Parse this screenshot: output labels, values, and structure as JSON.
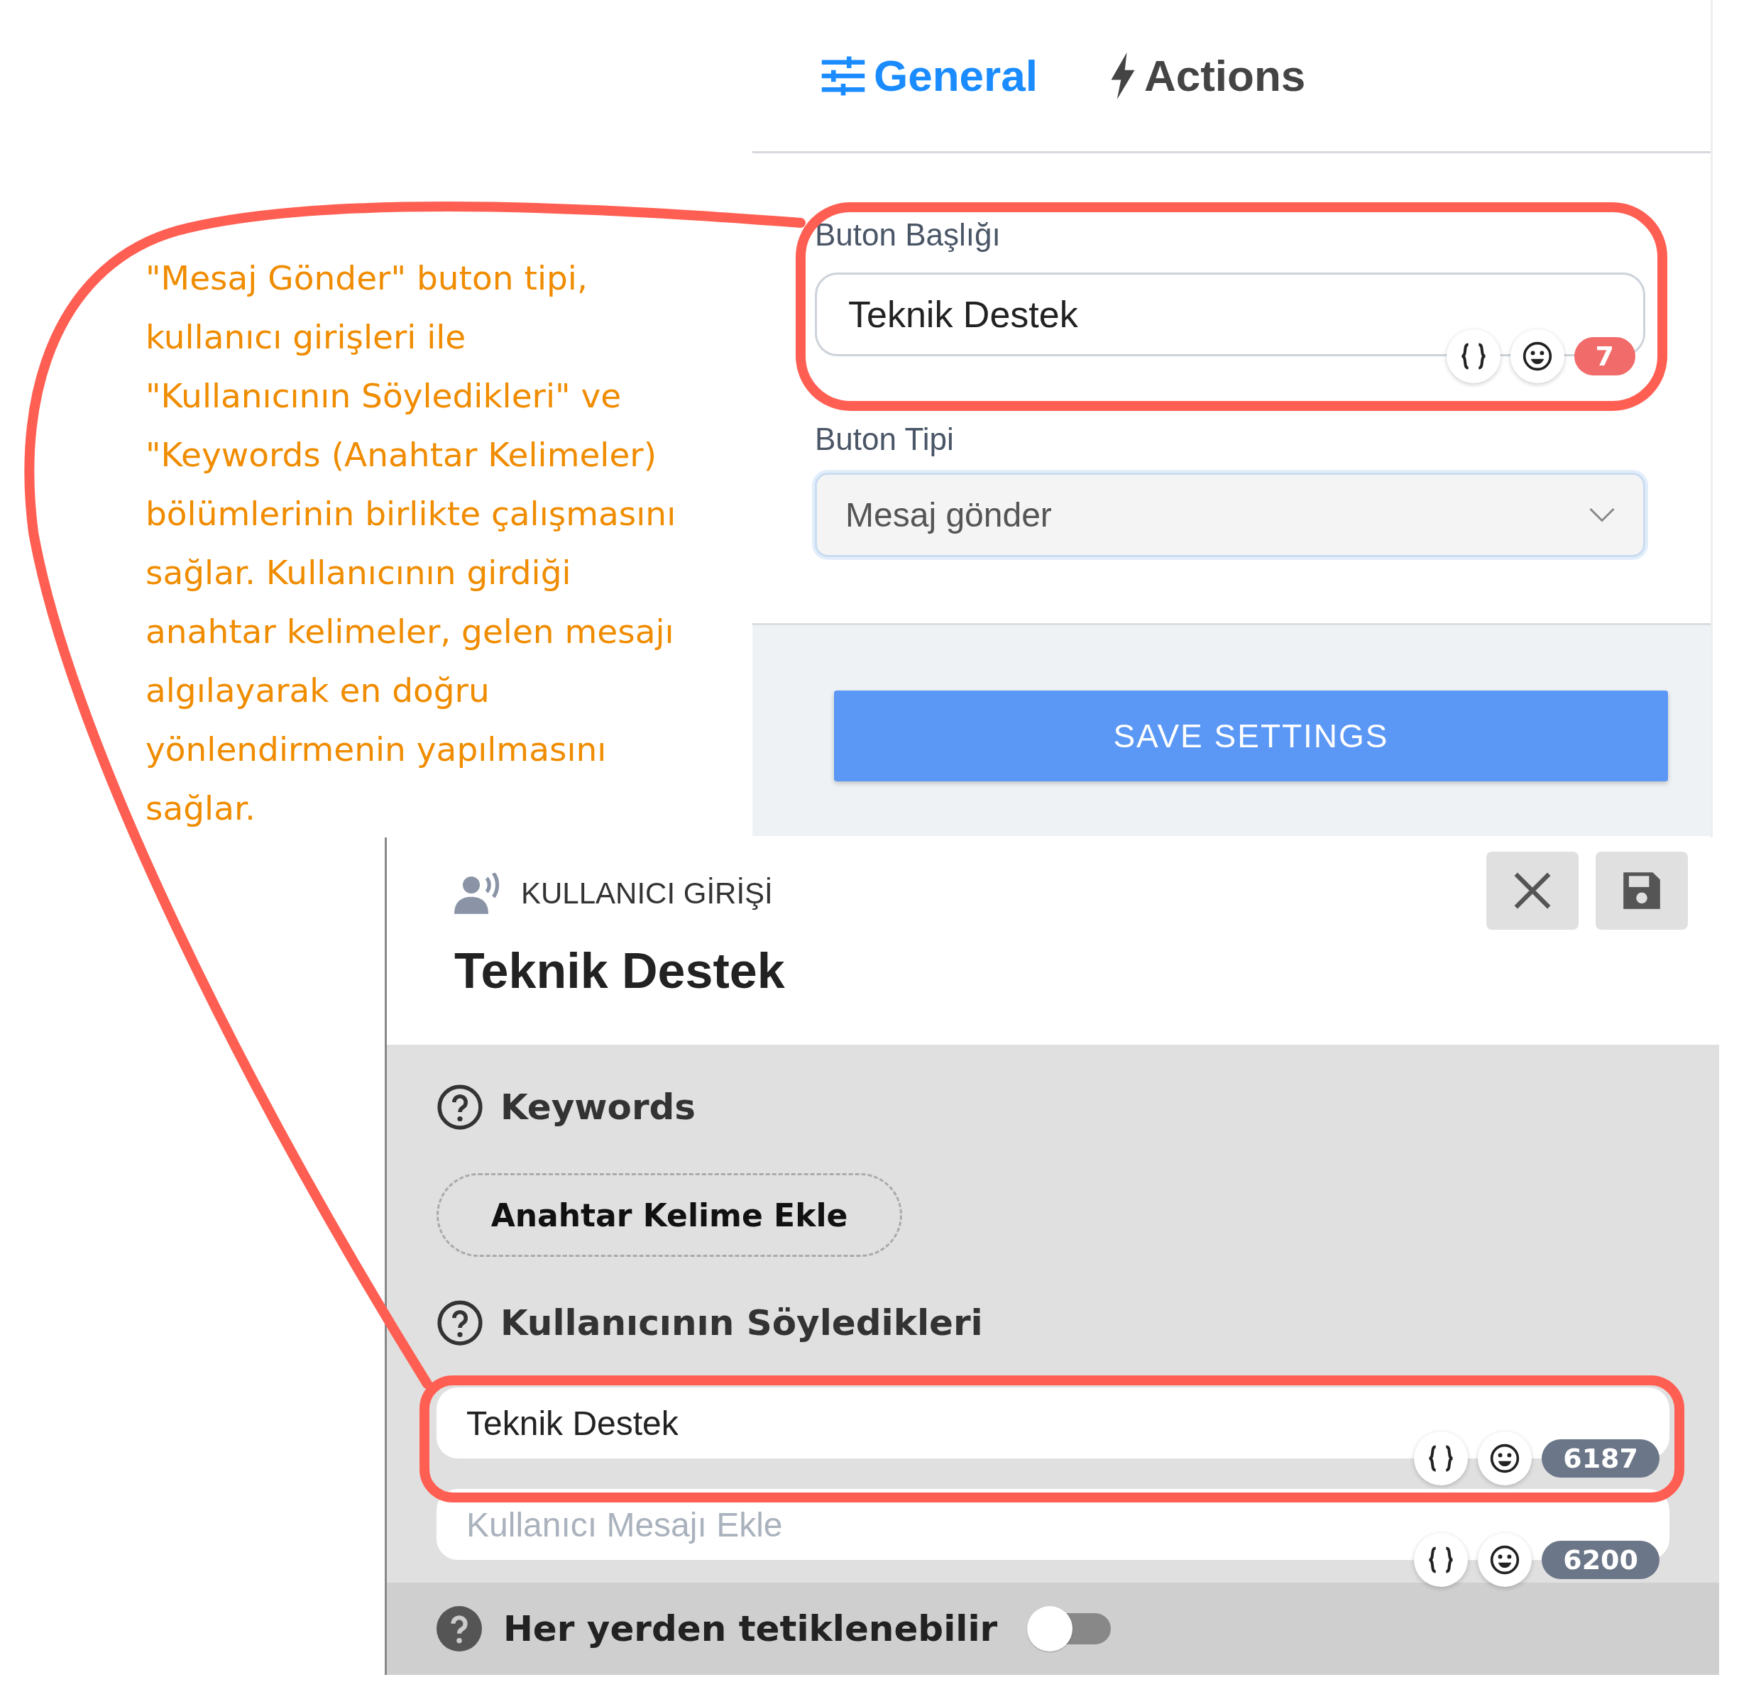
{
  "tabs": [
    {
      "label": "General",
      "selected": true
    },
    {
      "label": "Actions",
      "selected": false
    }
  ],
  "button_settings": {
    "title_field": {
      "label": "Buton Başlığı",
      "value": "Teknik Destek",
      "count": "7"
    },
    "type_field": {
      "label": "Buton Tipi",
      "value": "Mesaj gönder"
    },
    "save_button": "SAVE SETTINGS"
  },
  "user_input_panel": {
    "kind_label": "KULLANICI GİRİŞİ",
    "title": "Teknik Destek",
    "keywords": {
      "heading": "Keywords",
      "add_button": "Anahtar Kelime Ekle"
    },
    "utterances": {
      "heading": "Kullanıcının Söyledikleri",
      "items": [
        {
          "value": "Teknik Destek",
          "count": "6187"
        },
        {
          "placeholder": "Kullanıcı Mesajı Ekle",
          "count": "6200"
        }
      ]
    },
    "trigger_anywhere": {
      "label": "Her yerden tetiklenebilir",
      "on": false
    }
  },
  "annotation": {
    "lines": [
      "\"Mesaj Gönder\" buton tipi,",
      "kullanıcı girişleri ile",
      "\"Kullanıcının Söyledikleri\" ve",
      "\"Keywords (Anahtar Kelimeler)",
      "bölümlerinin birlikte çalışmasını",
      "sağlar. Kullanıcının girdiği",
      "anahtar kelimeler, gelen mesajı",
      "algılayarak en doğru",
      "yönlendirmenin yapılmasını",
      "sağlar."
    ]
  }
}
